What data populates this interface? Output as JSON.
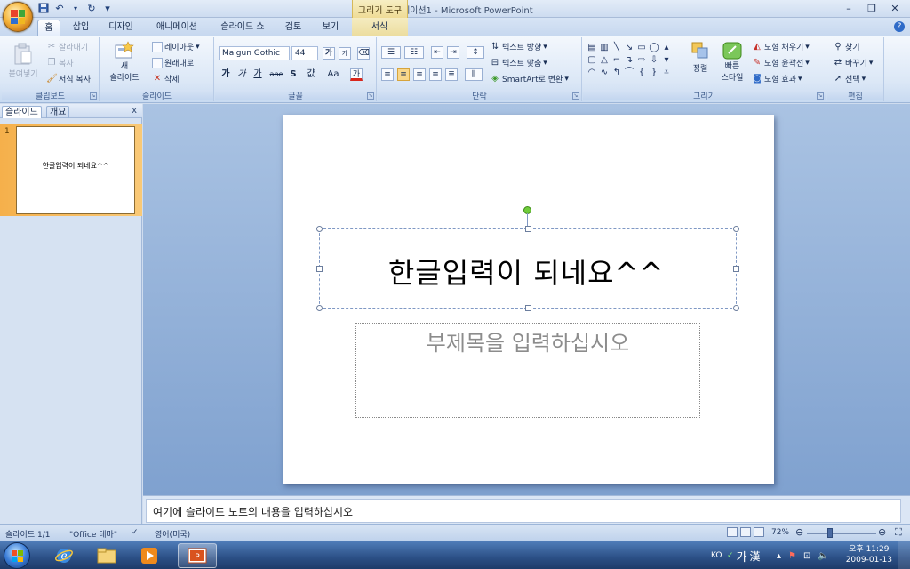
{
  "titlebar": {
    "title": "프레젠테이션1 - Microsoft PowerPoint",
    "context_tool_label": "그리기 도구",
    "minimize": "–",
    "maximize": "❐",
    "close": "✕",
    "qat_save_icon": "save-icon",
    "qat_undo": "↶",
    "qat_redo": "↻",
    "qat_customize": "▾"
  },
  "tabs": [
    "홈",
    "삽입",
    "디자인",
    "애니메이션",
    "슬라이드 쇼",
    "검토",
    "보기",
    "서식"
  ],
  "active_tab": "홈",
  "ribbon": {
    "clipboard": {
      "label": "클립보드",
      "paste": "붙여넣기",
      "cut": "잘라내기",
      "copy": "복사",
      "format_painter": "서식 복사"
    },
    "slides": {
      "label": "슬라이드",
      "new_slide_line1": "새",
      "new_slide_line2": "슬라이드",
      "layout": "레이아웃",
      "reset": "원래대로",
      "delete": "삭제"
    },
    "font": {
      "label": "글꼴",
      "font_name": "Malgun Gothic",
      "font_size": "44",
      "grow": "가",
      "shrink": "가",
      "bold": "가",
      "italic": "가",
      "underline": "가",
      "strike": "abe",
      "shadow": "S",
      "spacing": "걊",
      "case": "Aa",
      "color": "가"
    },
    "paragraph": {
      "label": "단락",
      "text_direction": "텍스트 방향",
      "align_text": "텍스트 맞춤",
      "smartart": "SmartArt로 변환"
    },
    "drawing": {
      "label": "그리기",
      "arrange": "정렬",
      "quick_styles_line1": "빠른",
      "quick_styles_line2": "스타일",
      "shape_fill": "도형 채우기",
      "shape_outline": "도형 윤곽선",
      "shape_effects": "도형 효과"
    },
    "editing": {
      "label": "편집",
      "find": "찾기",
      "replace": "바꾸기",
      "select": "선택"
    }
  },
  "left_pane": {
    "tab_slides": "슬라이드",
    "tab_outline": "개요",
    "close": "x",
    "thumb_number": "1",
    "thumb_text": "한글입력이 되네요^^"
  },
  "slide": {
    "title": "한글입력이 되네요^^",
    "subtitle_placeholder": "부제목을 입력하십시오"
  },
  "notes": {
    "placeholder": "여기에 슬라이드 노트의 내용을 입력하십시오"
  },
  "statusbar": {
    "slide_count": "슬라이드 1/1",
    "theme": "\"Office 테마\"",
    "language": "영어(미국)",
    "zoom": "72%",
    "zoom_level_percent": 72
  },
  "taskbar": {
    "lang": "KO",
    "ime_hangul": "가",
    "ime_hanja": "漢",
    "time": "오후 11:29",
    "date": "2009-01-13"
  },
  "colors": {
    "accent_orange": "#f5b04b",
    "ribbon_blue": "#dbe7f6",
    "taskbar_blue": "#2b4f85"
  }
}
